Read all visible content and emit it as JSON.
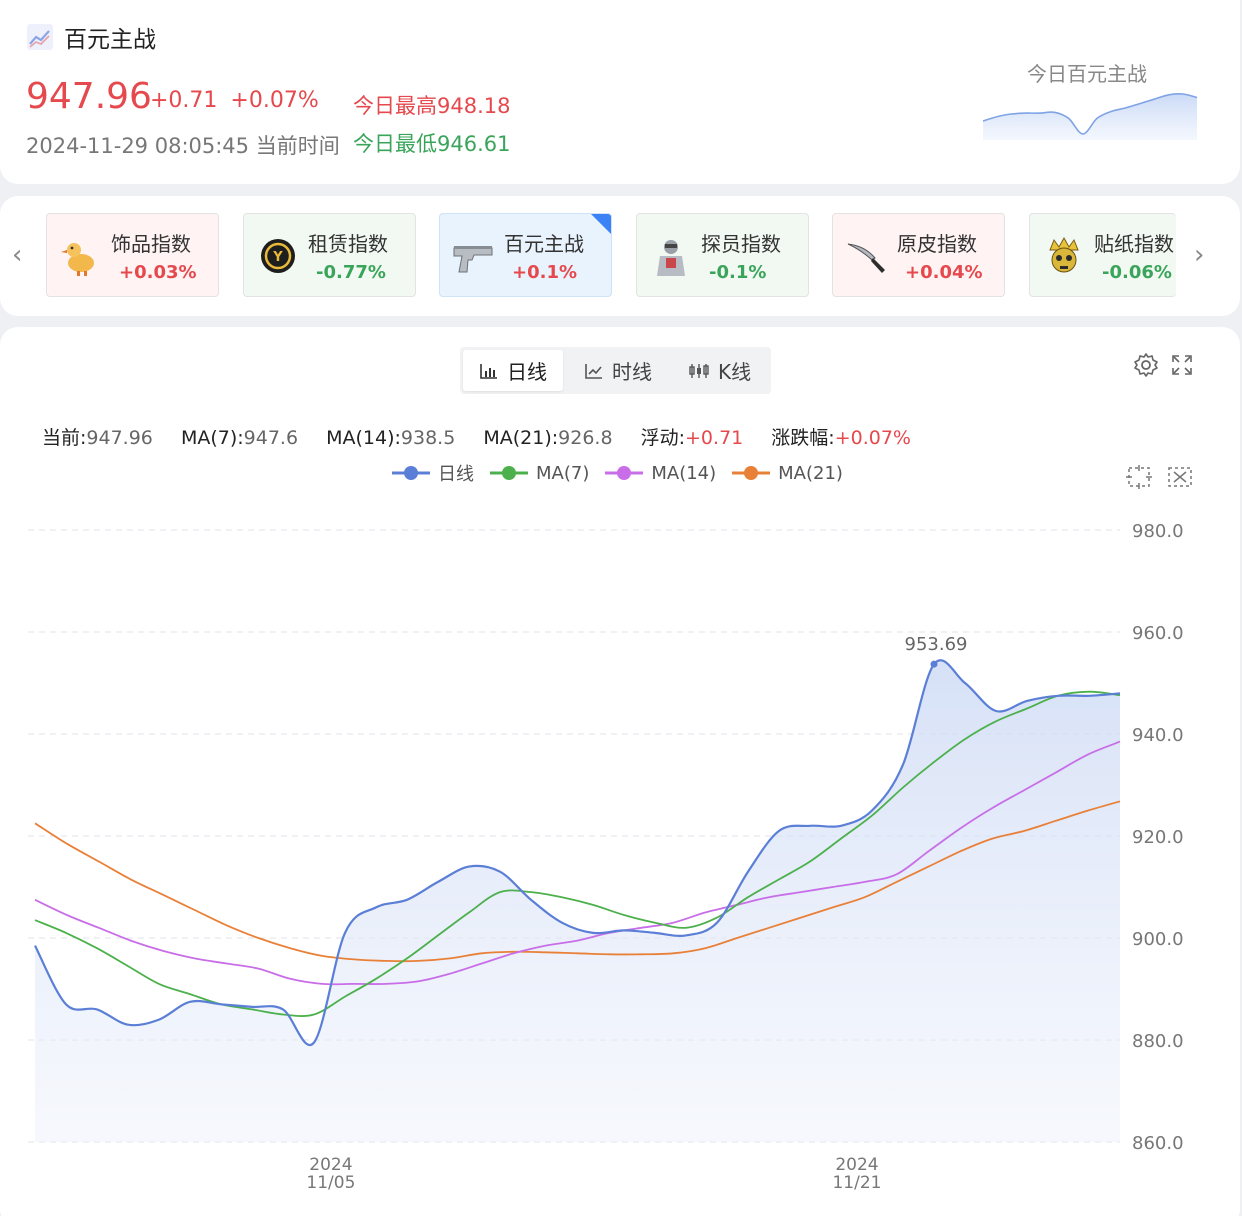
{
  "header": {
    "title": "百元主战",
    "price": "947.96",
    "change": "+0.71 +0.07%",
    "time": "2024-11-29 08:05:45 当前时间",
    "high": "今日最高948.18",
    "low": "今日最低946.61",
    "mini_label": "今日百元主战"
  },
  "tiles": [
    {
      "name": "饰品指数",
      "change": "+0.03%",
      "dir": "up",
      "icon": "duck-icon"
    },
    {
      "name": "租赁指数",
      "change": "-0.77%",
      "dir": "down",
      "icon": "coin-icon"
    },
    {
      "name": "百元主战",
      "change": "+0.1%",
      "dir": "up",
      "icon": "pistol-icon",
      "active": true
    },
    {
      "name": "探员指数",
      "change": "-0.1%",
      "dir": "down",
      "icon": "agent-icon"
    },
    {
      "name": "原皮指数",
      "change": "+0.04%",
      "dir": "up",
      "icon": "knife-icon"
    },
    {
      "name": "贴纸指数",
      "change": "-0.06%",
      "dir": "down",
      "icon": "crown-skull-icon"
    }
  ],
  "segmented": {
    "daily": "日线",
    "intraday": "时线",
    "kline": "K线"
  },
  "stats": {
    "current_label": "当前:",
    "current": "947.96",
    "ma7_label": "MA(7):",
    "ma7": "947.6",
    "ma14_label": "MA(14):",
    "ma14": "938.5",
    "ma21_label": "MA(21):",
    "ma21": "926.8",
    "float_label": "浮动:",
    "float": "+0.71",
    "pct_label": "涨跌幅:",
    "pct": "+0.07%"
  },
  "colors": {
    "up": "#e5484d",
    "down": "#3aa55a",
    "daily": "#5b7fd6",
    "ma7": "#4cb04c",
    "ma14": "#c86ee8",
    "ma21": "#e98038"
  },
  "chart_data": {
    "type": "line",
    "x": [
      "2024-10-27",
      "2024-10-28",
      "2024-10-29",
      "2024-10-30",
      "2024-10-31",
      "2024-11-01",
      "2024-11-02",
      "2024-11-03",
      "2024-11-04",
      "2024-11-05",
      "2024-11-06",
      "2024-11-07",
      "2024-11-08",
      "2024-11-09",
      "2024-11-10",
      "2024-11-11",
      "2024-11-12",
      "2024-11-13",
      "2024-11-14",
      "2024-11-15",
      "2024-11-16",
      "2024-11-17",
      "2024-11-18",
      "2024-11-19",
      "2024-11-20",
      "2024-11-21",
      "2024-11-22",
      "2024-11-23",
      "2024-11-24",
      "2024-11-25",
      "2024-11-26",
      "2024-11-27",
      "2024-11-28",
      "2024-11-29"
    ],
    "xticks": [
      {
        "x": "2024-11-05",
        "label": [
          "2024",
          "11/05"
        ]
      },
      {
        "x": "2024-11-21",
        "label": [
          "2024",
          "11/21"
        ]
      }
    ],
    "ylim": [
      860,
      980
    ],
    "yticks": [
      "860.0",
      "880.0",
      "900.0",
      "920.0",
      "940.0",
      "960.0",
      "980.0"
    ],
    "annotation": {
      "x": "2024-11-22",
      "value": 953.69,
      "label": "953.69"
    },
    "series": [
      {
        "name": "日线",
        "values": [
          898.5,
          887.0,
          886.0,
          883.0,
          884.0,
          887.5,
          887.0,
          886.5,
          886.0,
          879.5,
          901.0,
          906.0,
          907.5,
          911.0,
          914.0,
          913.0,
          907.5,
          903.0,
          901.0,
          901.5,
          901.0,
          900.5,
          903.0,
          913.0,
          921.0,
          922.0,
          922.0,
          925.0,
          934.0,
          953.69,
          950.0,
          944.5,
          946.5,
          947.5,
          947.5,
          947.96
        ]
      },
      {
        "name": "MA(7)",
        "values": [
          903.5,
          901.0,
          898.0,
          894.5,
          891.0,
          889.0,
          887.0,
          886.0,
          885.0,
          885.0,
          888.5,
          892.0,
          896.0,
          900.5,
          905.0,
          909.0,
          909.0,
          908.0,
          906.5,
          904.5,
          903.0,
          902.0,
          904.0,
          908.0,
          911.5,
          915.0,
          919.5,
          924.0,
          929.5,
          934.5,
          939.0,
          942.5,
          945.0,
          947.5,
          948.3,
          947.6
        ]
      },
      {
        "name": "MA(14)",
        "values": [
          907.5,
          904.5,
          902.0,
          899.5,
          897.5,
          896.0,
          895.0,
          894.0,
          892.0,
          891.0,
          891.0,
          891.0,
          891.5,
          893.0,
          895.0,
          897.0,
          898.5,
          899.5,
          901.0,
          902.0,
          903.0,
          905.0,
          906.5,
          908.0,
          909.0,
          910.0,
          911.0,
          912.5,
          917.0,
          921.5,
          925.5,
          929.0,
          932.5,
          936.0,
          938.5
        ]
      },
      {
        "name": "MA(21)",
        "values": [
          922.5,
          918.5,
          915.0,
          911.5,
          908.5,
          905.5,
          902.5,
          900.0,
          898.0,
          896.5,
          895.8,
          895.5,
          895.5,
          896.0,
          897.0,
          897.3,
          897.2,
          897.0,
          896.8,
          896.8,
          897.0,
          898.0,
          900.0,
          902.0,
          904.0,
          906.0,
          908.0,
          911.0,
          914.0,
          917.0,
          919.5,
          921.0,
          923.0,
          925.0,
          926.8
        ]
      }
    ]
  },
  "mini": {
    "values": [
      941.5,
      942.0,
      942.3,
      942.4,
      942.4,
      942.5,
      941.8,
      940.0,
      941.8,
      942.6,
      943.0,
      943.5,
      944.0,
      944.5,
      944.6,
      944.2
    ]
  }
}
